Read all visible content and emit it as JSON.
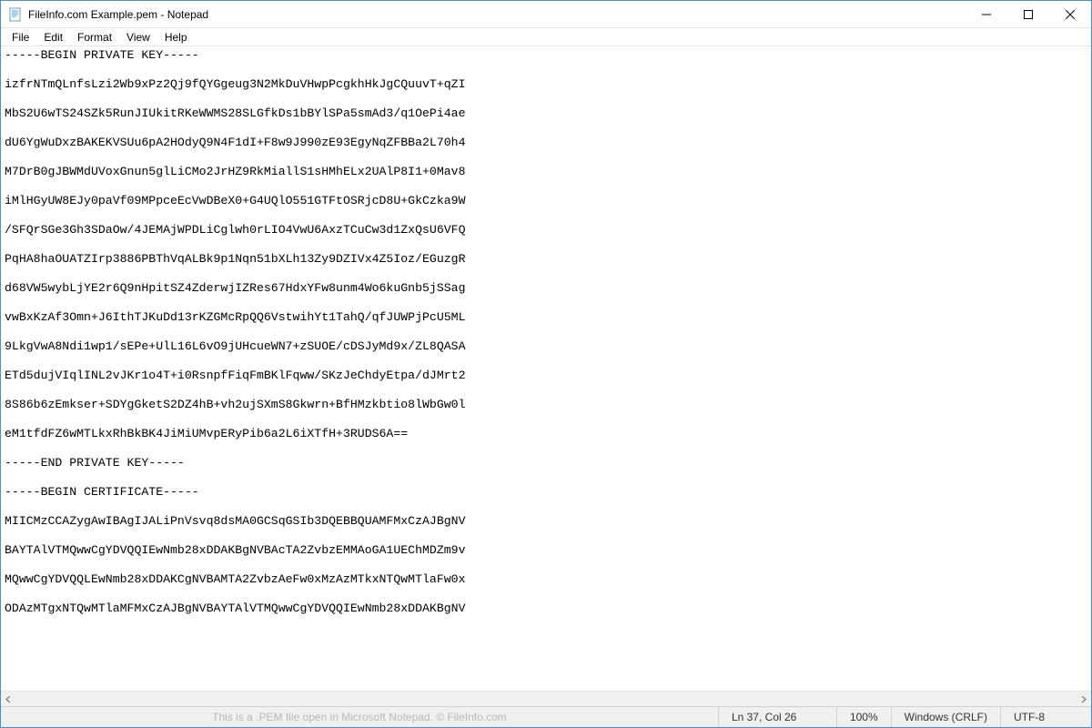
{
  "titlebar": {
    "title": "FileInfo.com Example.pem - Notepad"
  },
  "menu": {
    "file": "File",
    "edit": "Edit",
    "format": "Format",
    "view": "View",
    "help": "Help"
  },
  "editor": {
    "content": "-----BEGIN PRIVATE KEY-----\n\nizfrNTmQLnfsLzi2Wb9xPz2Qj9fQYGgeug3N2MkDuVHwpPcgkhHkJgCQuuvT+qZI\n\nMbS2U6wTS24SZk5RunJIUkitRKeWWMS28SLGfkDs1bBYlSPa5smAd3/q1OePi4ae\n\ndU6YgWuDxzBAKEKVSUu6pA2HOdyQ9N4F1dI+F8w9J990zE93EgyNqZFBBa2L70h4\n\nM7DrB0gJBWMdUVoxGnun5glLiCMo2JrHZ9RkMiallS1sHMhELx2UAlP8I1+0Mav8\n\niMlHGyUW8EJy0paVf09MPpceEcVwDBeX0+G4UQlO551GTFtOSRjcD8U+GkCzka9W\n\n/SFQrSGe3Gh3SDaOw/4JEMAjWPDLiCglwh0rLIO4VwU6AxzTCuCw3d1ZxQsU6VFQ\n\nPqHA8haOUATZIrp3886PBThVqALBk9p1Nqn51bXLh13Zy9DZIVx4Z5Ioz/EGuzgR\n\nd68VW5wybLjYE2r6Q9nHpitSZ4ZderwjIZRes67HdxYFw8unm4Wo6kuGnb5jSSag\n\nvwBxKzAf3Omn+J6IthTJKuDd13rKZGMcRpQQ6VstwihYt1TahQ/qfJUWPjPcU5ML\n\n9LkgVwA8Ndi1wp1/sEPe+UlL16L6vO9jUHcueWN7+zSUOE/cDSJyMd9x/ZL8QASA\n\nETd5dujVIqlINL2vJKr1o4T+i0RsnpfFiqFmBKlFqww/SKzJeChdyEtpa/dJMrt2\n\n8S86b6zEmkser+SDYgGketS2DZ4hB+vh2ujSXmS8Gkwrn+BfHMzkbtio8lWbGw0l\n\neM1tfdFZ6wMTLkxRhBkBK4JiMiUMvpERyPib6a2L6iXTfH+3RUDS6A==\n\n-----END PRIVATE KEY-----\n\n-----BEGIN CERTIFICATE-----\n\nMIICMzCCAZygAwIBAgIJALiPnVsvq8dsMA0GCSqGSIb3DQEBBQUAMFMxCzAJBgNV\n\nBAYTAlVTMQwwCgYDVQQIEwNmb28xDDAKBgNVBAcTA2ZvbzEMMAoGA1UEChMDZm9v\n\nMQwwCgYDVQQLEwNmb28xDDAKCgNVBAMTA2ZvbzAeFw0xMzAzMTkxNTQwMTlaFw0x\n\nODAzMTgxNTQwMTlaMFMxCzAJBgNVBAYTAlVTMQwwCgYDVQQIEwNmb28xDDAKBgNV\n\n\n\n\n\n\n\n\n\n\n\n\n\n\n\n\n\n\n\n\n"
  },
  "statusbar": {
    "watermark": "This is a .PEM file open in Microsoft Notepad. © FileInfo.com",
    "position": "Ln 37, Col 26",
    "zoom": "100%",
    "line_ending": "Windows (CRLF)",
    "encoding": "UTF-8"
  }
}
